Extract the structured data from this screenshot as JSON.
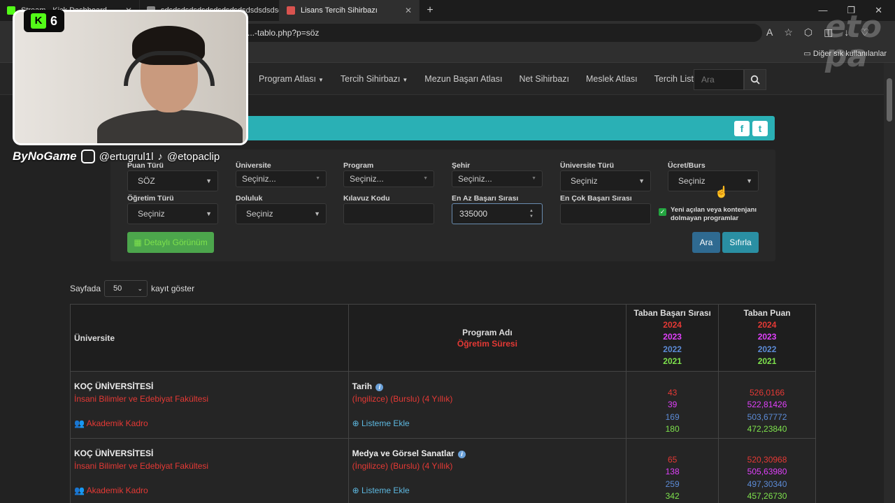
{
  "browser": {
    "tabs": [
      {
        "label": "Stream - Kick Dashboard",
        "favicon_color": "#53fc18"
      },
      {
        "label": "sdsdsdsdsdsdsdsdsdsdsdsdsdsdsd",
        "favicon_color": "#888888"
      },
      {
        "label": "Lisans Tercih Sihirbazı",
        "favicon_color": "#d9534f"
      }
    ],
    "new_tab": "+",
    "url": "...-tablo.php?p=söz",
    "favorites_other": "Diğer sık kullanılanlar"
  },
  "nav": {
    "items": [
      {
        "label": "Program Atlası",
        "dropdown": true
      },
      {
        "label": "Tercih Sihirbazı",
        "dropdown": true
      },
      {
        "label": "Mezun Başarı Atlası",
        "dropdown": false
      },
      {
        "label": "Net Sihirbazı",
        "dropdown": false
      },
      {
        "label": "Meslek Atlası",
        "dropdown": false
      },
      {
        "label": "Tercih Listem",
        "dropdown": false
      }
    ],
    "search_placeholder": "Ara"
  },
  "filters": {
    "puan_turu": {
      "label": "Puan Türü",
      "value": "SÖZ"
    },
    "universite": {
      "label": "Üniversite",
      "value": "Seçiniz..."
    },
    "program": {
      "label": "Program",
      "value": "Seçiniz..."
    },
    "sehir": {
      "label": "Şehir",
      "value": "Seçiniz..."
    },
    "universite_turu": {
      "label": "Üniversite Türü",
      "value": "Seçiniz"
    },
    "ucret_burs": {
      "label": "Ücret/Burs",
      "value": "Seçiniz"
    },
    "ogretim_turu": {
      "label": "Öğretim Türü",
      "value": "Seçiniz"
    },
    "doluluk": {
      "label": "Doluluk",
      "value": "Seçiniz"
    },
    "kilavuz_kodu": {
      "label": "Kılavuz Kodu",
      "value": ""
    },
    "en_az": {
      "label": "En Az Başarı Sırası",
      "value": "335000"
    },
    "en_cok": {
      "label": "En Çok Başarı Sırası",
      "value": ""
    },
    "checkbox_text_1": "Yeni açılan veya kontenjanı",
    "checkbox_text_2": "dolmayan programlar",
    "detail_button": "Detaylı Görünüm",
    "search_button": "Ara",
    "reset_button": "Sıfırla"
  },
  "page_size": {
    "prefix": "Sayfada",
    "value": "50",
    "suffix": "kayıt göster"
  },
  "table": {
    "headers": {
      "universite": "Üniversite",
      "program": "Program Adı",
      "ogretim_suresi": "Öğretim Süresi",
      "taban_basari": "Taban Başarı Sırası",
      "taban_puan": "Taban Puan",
      "years": [
        "2024",
        "2023",
        "2022",
        "2021"
      ]
    },
    "rows": [
      {
        "university": "KOÇ ÜNİVERSİTESİ",
        "faculty": "İnsani Bilimler ve Edebiyat Fakültesi",
        "akademik": "Akademik Kadro",
        "program": "Tarih",
        "detail": "(İngilizce) (Burslu) (4 Yıllık)",
        "liste": "Listeme Ekle",
        "ranks": [
          "43",
          "39",
          "169",
          "180"
        ],
        "scores": [
          "526,0166",
          "522,81426",
          "503,67772",
          "472,23840"
        ]
      },
      {
        "university": "KOÇ ÜNİVERSİTESİ",
        "faculty": "İnsani Bilimler ve Edebiyat Fakültesi",
        "akademik": "Akademik Kadro",
        "program": "Medya ve Görsel Sanatlar",
        "detail": "(İngilizce) (Burslu) (4 Yıllık)",
        "liste": "Listeme Ekle",
        "ranks": [
          "65",
          "138",
          "259",
          "342"
        ],
        "scores": [
          "520,30968",
          "505,63980",
          "497,30340",
          "457,26730"
        ]
      }
    ]
  },
  "overlay": {
    "kick_count": "6",
    "brand": "ByNoGame",
    "handle_instagram": "@ertugrul1l",
    "handle_tiktok": "@etopaclip",
    "watermark_1": "eto",
    "watermark_2": "pa"
  },
  "colors": {
    "y2024": "#e53935",
    "y2023": "#e040fb",
    "y2022": "#5c8bd6",
    "y2021": "#7ee24d",
    "teal_bar": "#2ab0b5"
  }
}
